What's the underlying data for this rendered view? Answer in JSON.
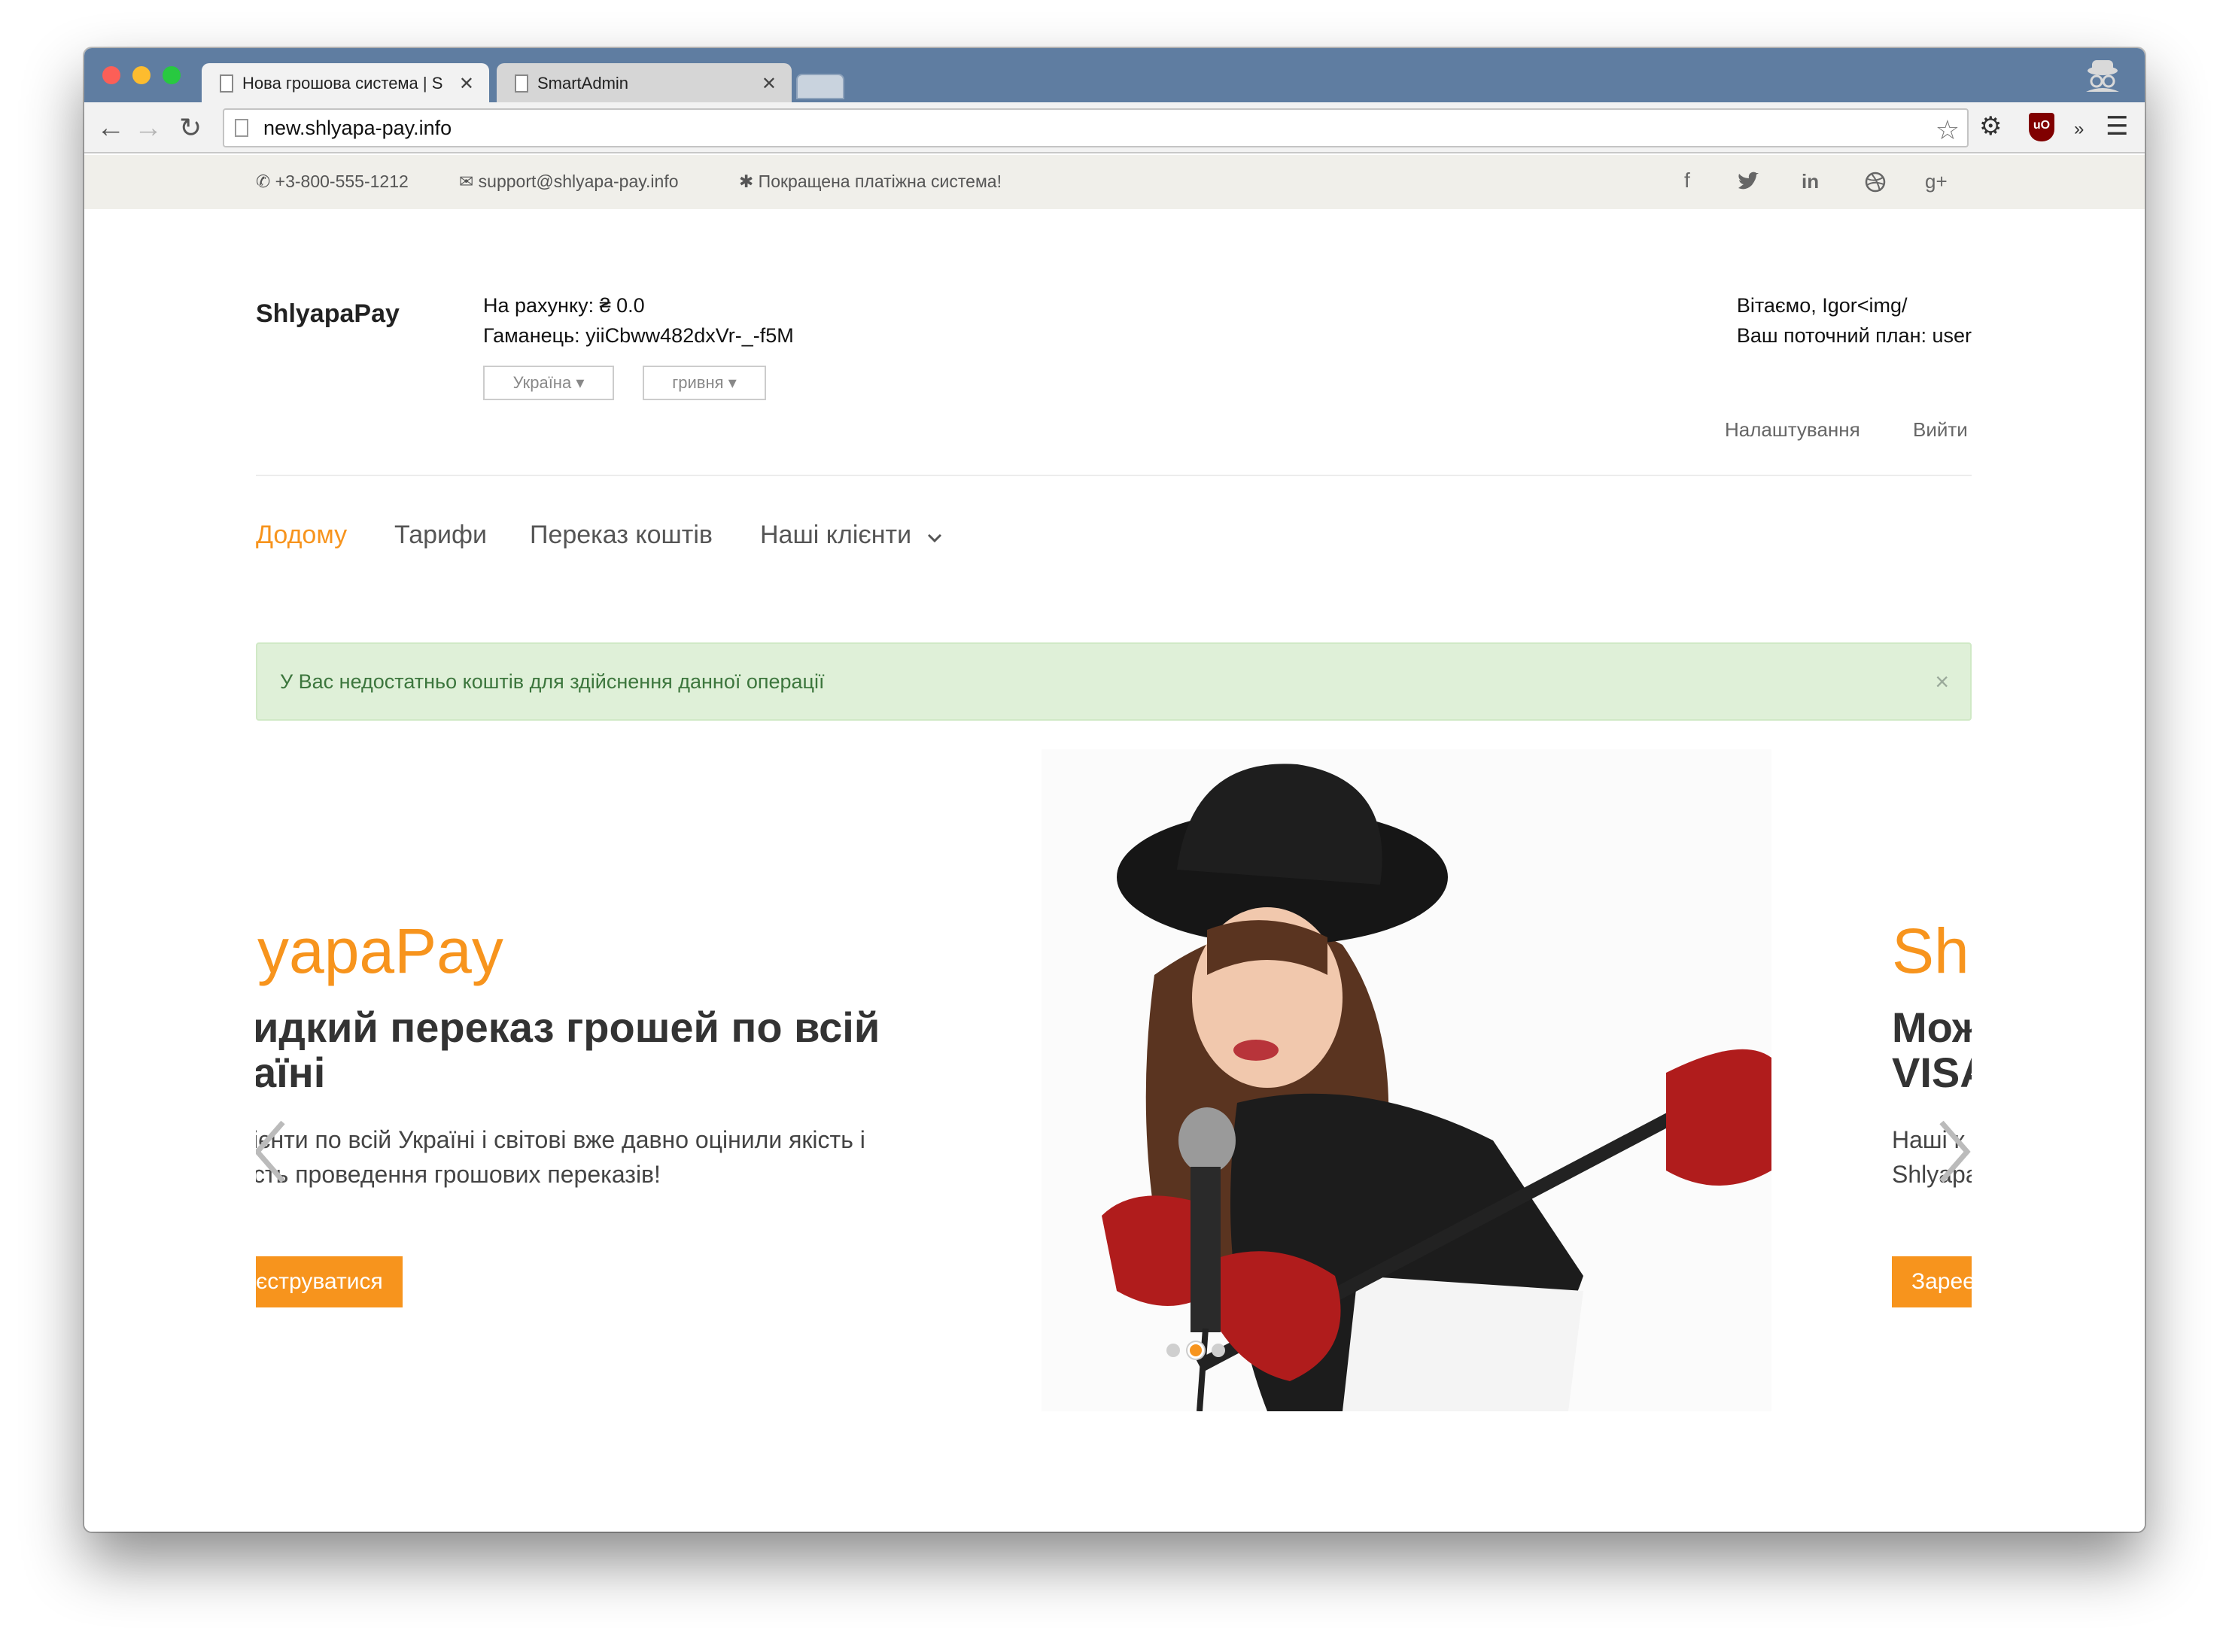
{
  "browser": {
    "tabs": [
      {
        "title": "Нова грошова система | S",
        "close": "✕"
      },
      {
        "title": "SmartAdmin",
        "close": "✕"
      }
    ],
    "url": "new.shlyapa-pay.info"
  },
  "topbar": {
    "phone": "+3-800-555-1212",
    "email": "support@shlyapa-pay.info",
    "tagline": "Покращена платіжна система!"
  },
  "header": {
    "brand": "ShlyapaPay",
    "balance": "На рахунку: ₴ 0.0",
    "wallet": "Гаманець: yiiCbww482dxVr-_-f5M",
    "country": "Україна",
    "currency": "гривня",
    "greeting": "Вітаємо, Igor<img/",
    "plan": "Ваш поточний план: user",
    "settings": "Налаштування",
    "logout": "Вийти"
  },
  "nav": {
    "home": "Додому",
    "tariffs": "Тарифи",
    "transfer": "Переказ коштів",
    "clients": "Наші клієнти"
  },
  "alert": {
    "message": "У Вас недостатньо коштів для здійснення данної операції",
    "close": "×"
  },
  "carousel": {
    "left": {
      "title": "yapaPay",
      "sub1": "идкий переказ грошей по всій",
      "sub2": "аїні",
      "text1": "ієнти по всій Україні і світові вже давно оцінили якість і",
      "text2": "сть проведення грошових переказів!",
      "button": "єструватися"
    },
    "right": {
      "title": "Shl",
      "sub1": "Мож",
      "sub2": "VISA",
      "text1": "Наші к",
      "text2": "Shlyapa",
      "button": "Зарее"
    },
    "active_slide": 2,
    "slide_count": 3
  }
}
